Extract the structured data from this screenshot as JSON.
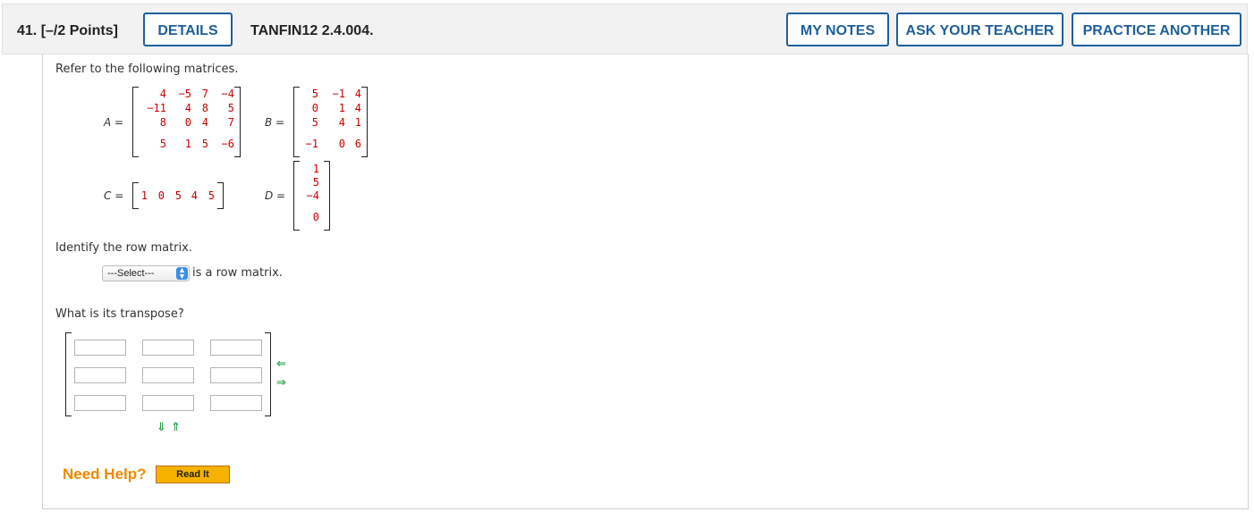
{
  "header": {
    "question_label": "41. [–/2 Points]",
    "details_label": "DETAILS",
    "code": "TANFIN12 2.4.004.",
    "my_notes_label": "MY NOTES",
    "ask_teacher_label": "ASK YOUR TEACHER",
    "practice_label": "PRACTICE ANOTHER"
  },
  "prompt": "Refer to the following matrices.",
  "matrices": {
    "A_label": "A =",
    "A": [
      [
        "4",
        "−5",
        "7",
        "−4"
      ],
      [
        "−11",
        "4",
        "8",
        "5"
      ],
      [
        "8",
        "0",
        "4",
        "7"
      ],
      [
        "5",
        "1",
        "5",
        "−6"
      ]
    ],
    "B_label": "B =",
    "B": [
      [
        "5",
        "−1",
        "4"
      ],
      [
        "0",
        "1",
        "4"
      ],
      [
        "5",
        "4",
        "1"
      ],
      [
        "−1",
        "0",
        "6"
      ]
    ],
    "C_label": "C =",
    "C": [
      "1",
      "0",
      "5",
      "4",
      "5"
    ],
    "D_label": "D =",
    "D": [
      "1",
      "5",
      "−4",
      "0"
    ]
  },
  "question1": "Identify the row matrix.",
  "select": {
    "value": "---Select---",
    "suffix": "is a row matrix."
  },
  "question2": "What is its transpose?",
  "transpose": {
    "rows": 3,
    "cols": 3,
    "arrows": {
      "left": "⇐",
      "right": "⇒",
      "down": "⇓",
      "up": "⇑"
    }
  },
  "help": {
    "label": "Need Help?",
    "read_it": "Read It"
  },
  "colors": {
    "accent": "#1f5f9c",
    "matrix_text": "#cc0000",
    "help": "#f08a00",
    "arrow": "#2aa24a"
  }
}
